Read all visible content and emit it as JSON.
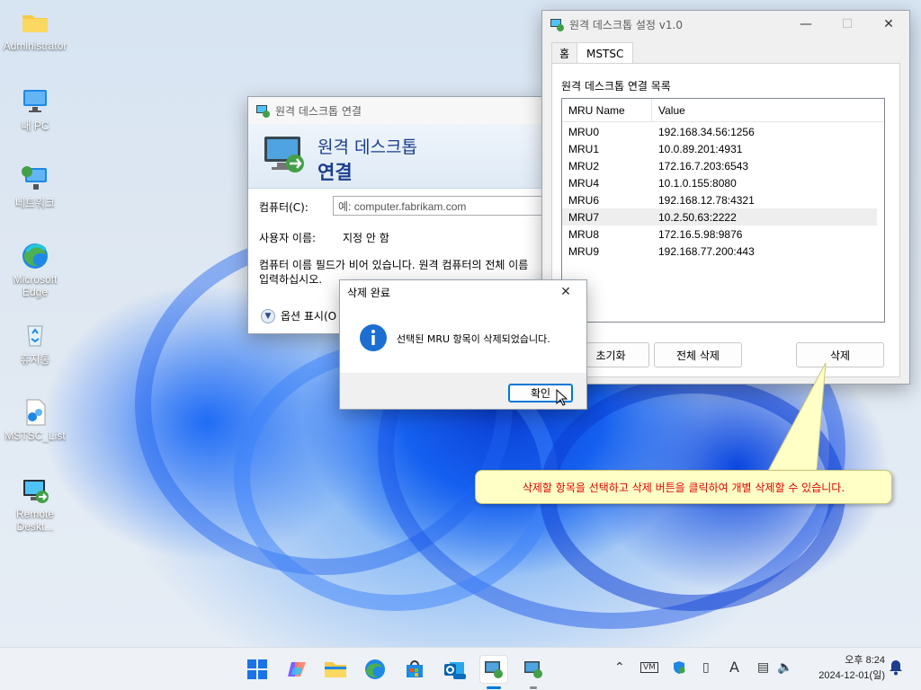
{
  "desktop": {
    "icons": [
      {
        "label": "Administrator",
        "icon": "folder-icon"
      },
      {
        "label": "내 PC",
        "icon": "computer-icon"
      },
      {
        "label": "네트워크",
        "icon": "network-icon"
      },
      {
        "label": "Microsoft Edge",
        "icon": "edge-icon"
      },
      {
        "label": "휴지통",
        "icon": "recycle-bin-icon"
      },
      {
        "label": "MSTSC_List",
        "icon": "batch-file-icon"
      },
      {
        "label": "Remote Deskt...",
        "icon": "remote-desktop-icon"
      }
    ]
  },
  "settings_window": {
    "title": "원격 데스크톱 설정 v1.0",
    "tabs": [
      {
        "label": "홈",
        "active": false
      },
      {
        "label": "MSTSC",
        "active": true
      }
    ],
    "list_label": "원격 데스크톱 연결 목록",
    "columns": [
      "MRU Name",
      "Value"
    ],
    "rows": [
      {
        "name": "MRU0",
        "value": "192.168.34.56:1256",
        "selected": false
      },
      {
        "name": "MRU1",
        "value": "10.0.89.201:4931",
        "selected": false
      },
      {
        "name": "MRU2",
        "value": "172.16.7.203:6543",
        "selected": false
      },
      {
        "name": "MRU4",
        "value": "10.1.0.155:8080",
        "selected": false
      },
      {
        "name": "MRU6",
        "value": "192.168.12.78:4321",
        "selected": false
      },
      {
        "name": "MRU7",
        "value": "10.2.50.63:2222",
        "selected": true
      },
      {
        "name": "MRU8",
        "value": "172.16.5.98:9876",
        "selected": false
      },
      {
        "name": "MRU9",
        "value": "192.168.77.200:443",
        "selected": false
      }
    ],
    "buttons": {
      "reset": "초기화",
      "delete_all": "전체 삭제",
      "delete": "삭제"
    }
  },
  "rdc_window": {
    "title": "원격 데스크톱 연결",
    "banner_line1": "원격 데스크톱",
    "banner_line2": "연결",
    "computer_label": "컴퓨터(C):",
    "computer_placeholder": "예: computer.fabrikam.com",
    "user_label": "사용자 이름:",
    "user_value": "지정 안 함",
    "info_line1": "컴퓨터 이름 필드가 비어 있습니다. 원격 컴퓨터의 전체 이름",
    "info_line2": "입력하십시오.",
    "options_label": "옵션 표시(O"
  },
  "message_dialog": {
    "title": "삭제 완료",
    "message": "선택된 MRU 항목이 삭제되었습니다.",
    "ok_label": "확인",
    "icon": "info-icon"
  },
  "callout": {
    "text": "삭제할 항목을 선택하고 삭제 버튼을 클릭하여 개별 삭제할 수 있습니다."
  },
  "taskbar": {
    "apps": [
      "start-icon",
      "copilot-icon",
      "file-explorer-icon",
      "edge-icon",
      "store-icon",
      "outlook-icon",
      "remote-desktop-icon",
      "remote-desktop-icon"
    ],
    "clock_time": "오후 8:24",
    "clock_date": "2024-12-01(일)",
    "tray_letter": "A"
  },
  "colors": {
    "accent": "#0078d4",
    "title_blue": "#1a3d8f",
    "callout_text": "#e00000",
    "callout_bg": "#ffffc6"
  }
}
